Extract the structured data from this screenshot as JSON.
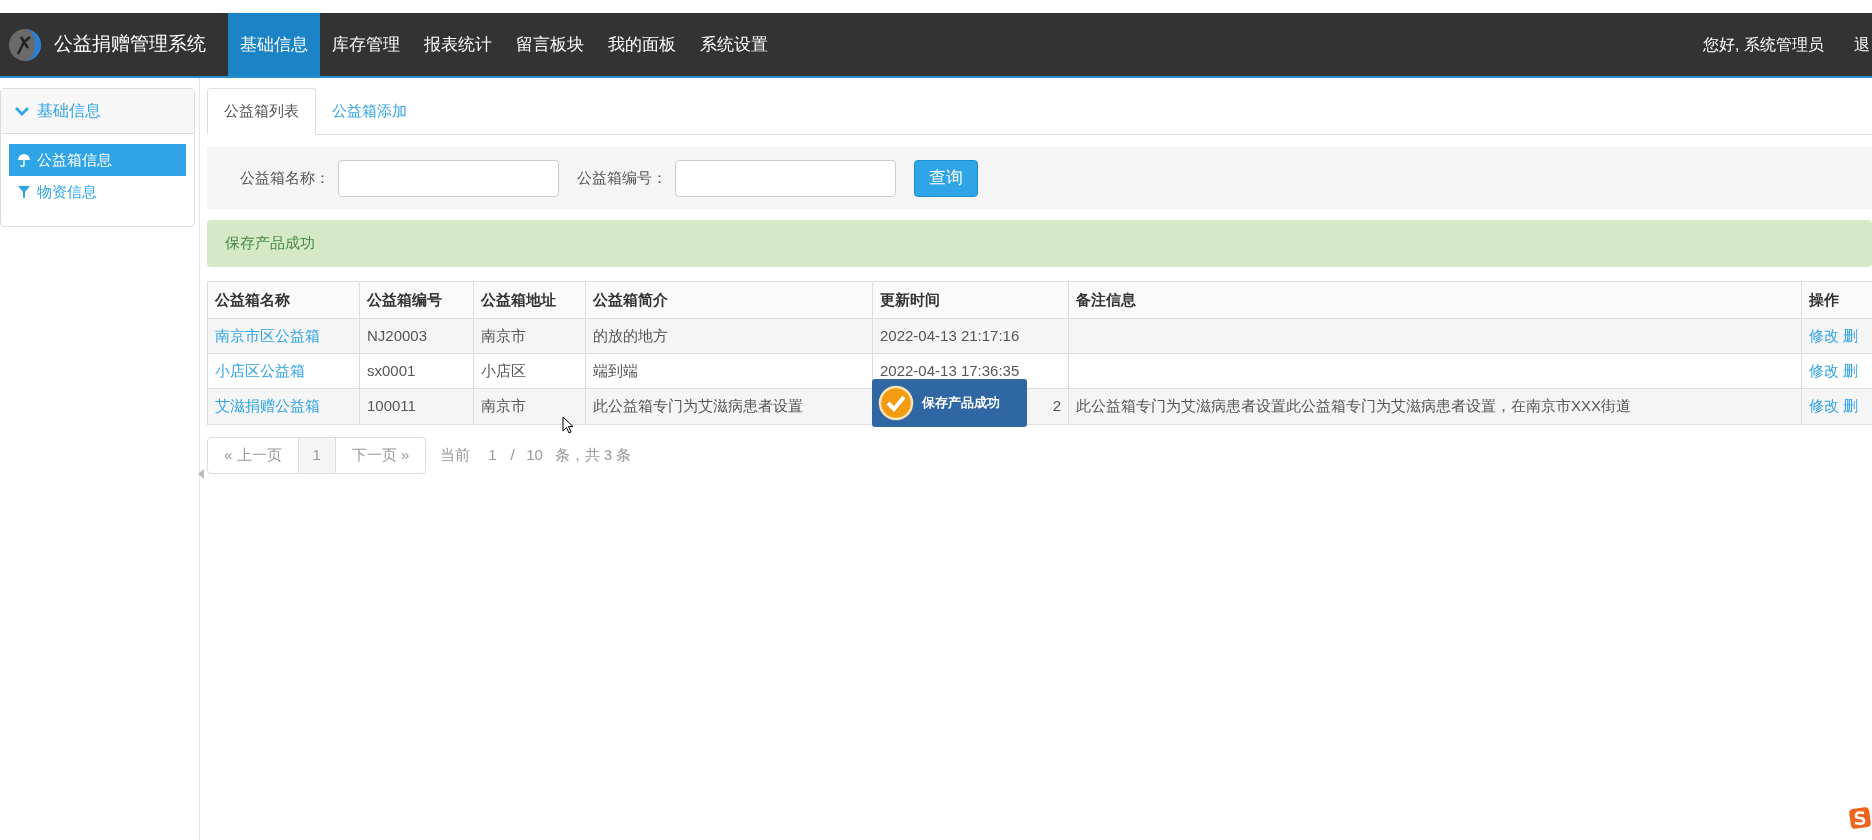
{
  "navbar": {
    "brand": "公益捐赠管理系统",
    "items": [
      {
        "label": "基础信息",
        "selected": true
      },
      {
        "label": "库存管理",
        "selected": false
      },
      {
        "label": "报表统计",
        "selected": false
      },
      {
        "label": "留言板块",
        "selected": false
      },
      {
        "label": "我的面板",
        "selected": false
      },
      {
        "label": "系统设置",
        "selected": false
      }
    ],
    "greeting": "您好, 系统管理员",
    "logout": "退"
  },
  "sidebar": {
    "title": "基础信息",
    "expanded": true,
    "items": [
      {
        "label": "公益箱信息",
        "kind": "umbrella",
        "selected": true
      },
      {
        "label": "物资信息",
        "kind": "filter",
        "selected": false
      }
    ]
  },
  "tabs": [
    {
      "label": "公益箱列表",
      "selected": true
    },
    {
      "label": "公益箱添加",
      "selected": false
    }
  ],
  "search": {
    "fields": [
      {
        "label": "公益箱名称："
      },
      {
        "label": "公益箱编号："
      }
    ],
    "button": "查询"
  },
  "alert": {
    "message": "保存产品成功"
  },
  "table": {
    "columns": [
      "公益箱名称",
      "公益箱编号",
      "公益箱地址",
      "公益箱简介",
      "更新时间",
      "备注信息",
      "操作"
    ],
    "rows": [
      {
        "name": "南京市区公益箱",
        "code": "NJ20003",
        "address": "南京市",
        "intro": "的放的地方",
        "time": "2022-04-13 21:17:16",
        "note": "",
        "actions": [
          "修改",
          "删"
        ],
        "time_obscured": false
      },
      {
        "name": "小店区公益箱",
        "code": "sx0001",
        "address": "小店区",
        "intro": "端到端",
        "time": "2022-04-13 17:36:35",
        "note": "",
        "actions": [
          "修改",
          "删"
        ],
        "time_obscured": false
      },
      {
        "name": "艾滋捐赠公益箱",
        "code": "100011",
        "address": "南京市",
        "intro": "此公益箱专门为艾滋病患者设置",
        "time": "2",
        "note": "此公益箱专门为艾滋病患者设置此公益箱专门为艾滋病患者设置，在南京市XXX街道",
        "actions": [
          "修改",
          "删"
        ],
        "time_obscured": true
      }
    ]
  },
  "pagination": {
    "prev": "« 上一页",
    "pages": [
      {
        "label": "1",
        "selected": true
      }
    ],
    "next": "下一页 »",
    "current_label": "当前",
    "current": "1",
    "separator": "/",
    "page_size": "10",
    "summary": "条，共 3 条"
  },
  "toast": {
    "message": "保存产品成功"
  }
}
